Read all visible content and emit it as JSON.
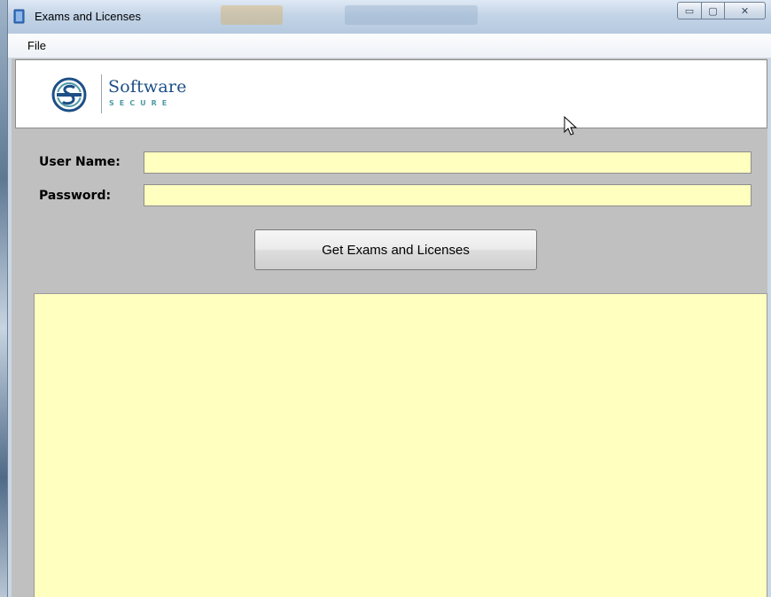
{
  "window": {
    "title": "Exams and Licenses",
    "controls": {
      "minimize_glyph": "▭",
      "maximize_glyph": "▢",
      "close_glyph": "✕"
    }
  },
  "menu": {
    "items": [
      {
        "label": "File"
      }
    ]
  },
  "logo": {
    "word": "Software",
    "subword": "SECURE",
    "icon": "software-secure-logo-icon",
    "colors": {
      "primary": "#1d4f86",
      "secondary": "#4f9aa6"
    }
  },
  "form": {
    "username": {
      "label": "User Name:",
      "value": ""
    },
    "password": {
      "label": "Password:",
      "value": ""
    },
    "submit_label": "Get Exams and Licenses"
  },
  "results": {
    "value": ""
  },
  "colors": {
    "input_background": "#ffffc0",
    "client_background": "#c0c0c0"
  }
}
